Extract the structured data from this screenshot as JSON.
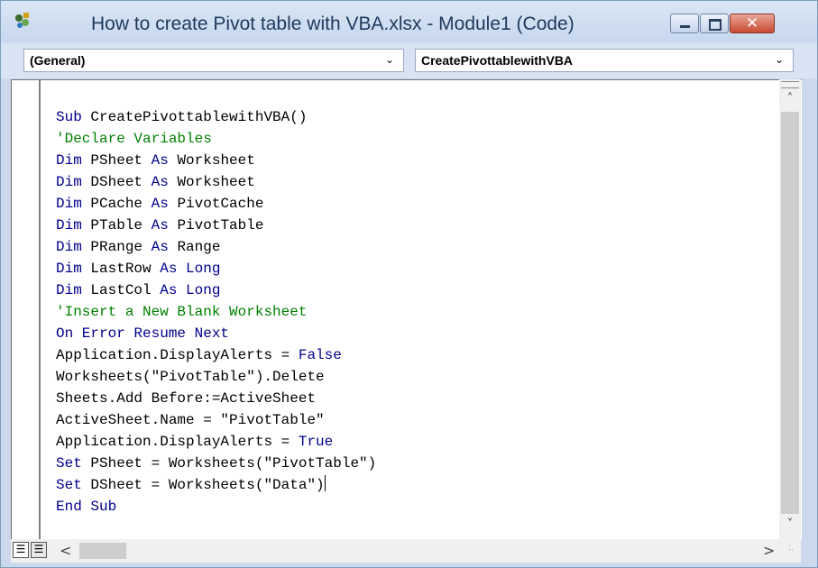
{
  "window": {
    "title": "How to create Pivot table with VBA.xlsx - Module1 (Code)",
    "icon": "vba-code-window-icon",
    "controls": {
      "minimize": "minimize-icon",
      "maximize": "maximize-icon",
      "close": "✕"
    }
  },
  "combos": {
    "object": {
      "value": "(General)",
      "arrow": "⌄"
    },
    "procedure": {
      "value": "CreatePivottablewithVBA",
      "arrow": "⌄"
    }
  },
  "code": {
    "lines": [
      [
        {
          "t": "kw",
          "v": "Sub "
        },
        {
          "t": "plain",
          "v": "CreatePivottablewithVBA()"
        }
      ],
      [
        {
          "t": "cm",
          "v": "'Declare Variables"
        }
      ],
      [
        {
          "t": "kw",
          "v": "Dim "
        },
        {
          "t": "plain",
          "v": "PSheet "
        },
        {
          "t": "kw",
          "v": "As "
        },
        {
          "t": "plain",
          "v": "Worksheet"
        }
      ],
      [
        {
          "t": "kw",
          "v": "Dim "
        },
        {
          "t": "plain",
          "v": "DSheet "
        },
        {
          "t": "kw",
          "v": "As "
        },
        {
          "t": "plain",
          "v": "Worksheet"
        }
      ],
      [
        {
          "t": "kw",
          "v": "Dim "
        },
        {
          "t": "plain",
          "v": "PCache "
        },
        {
          "t": "kw",
          "v": "As "
        },
        {
          "t": "plain",
          "v": "PivotCache"
        }
      ],
      [
        {
          "t": "kw",
          "v": "Dim "
        },
        {
          "t": "plain",
          "v": "PTable "
        },
        {
          "t": "kw",
          "v": "As "
        },
        {
          "t": "plain",
          "v": "PivotTable"
        }
      ],
      [
        {
          "t": "kw",
          "v": "Dim "
        },
        {
          "t": "plain",
          "v": "PRange "
        },
        {
          "t": "kw",
          "v": "As "
        },
        {
          "t": "plain",
          "v": "Range"
        }
      ],
      [
        {
          "t": "kw",
          "v": "Dim "
        },
        {
          "t": "plain",
          "v": "LastRow "
        },
        {
          "t": "kw",
          "v": "As Long"
        }
      ],
      [
        {
          "t": "kw",
          "v": "Dim "
        },
        {
          "t": "plain",
          "v": "LastCol "
        },
        {
          "t": "kw",
          "v": "As Long"
        }
      ],
      [
        {
          "t": "cm",
          "v": "'Insert a New Blank Worksheet"
        }
      ],
      [
        {
          "t": "kw",
          "v": "On Error Resume Next"
        }
      ],
      [
        {
          "t": "plain",
          "v": "Application.DisplayAlerts = "
        },
        {
          "t": "kw",
          "v": "False"
        }
      ],
      [
        {
          "t": "plain",
          "v": "Worksheets(\"PivotTable\").Delete"
        }
      ],
      [
        {
          "t": "plain",
          "v": "Sheets.Add Before:=ActiveSheet"
        }
      ],
      [
        {
          "t": "plain",
          "v": "ActiveSheet.Name = \"PivotTable\""
        }
      ],
      [
        {
          "t": "plain",
          "v": "Application.DisplayAlerts = "
        },
        {
          "t": "kw",
          "v": "True"
        }
      ],
      [
        {
          "t": "kw",
          "v": "Set "
        },
        {
          "t": "plain",
          "v": "PSheet = Worksheets(\"PivotTable\")"
        }
      ],
      [
        {
          "t": "kw",
          "v": "Set "
        },
        {
          "t": "plain",
          "v": "DSheet = Worksheets(\"Data\")"
        },
        {
          "t": "cursor",
          "v": ""
        }
      ],
      [
        {
          "t": "kw",
          "v": "End Sub"
        }
      ]
    ]
  },
  "scrollbars": {
    "up": "˄",
    "down": "˅",
    "left": "<",
    "right": ">"
  },
  "view_buttons": {
    "procedure_view": "☰",
    "full_module_view": "☰"
  },
  "colors": {
    "keyword": "#00008b",
    "comment": "#008000",
    "text": "#000000"
  }
}
